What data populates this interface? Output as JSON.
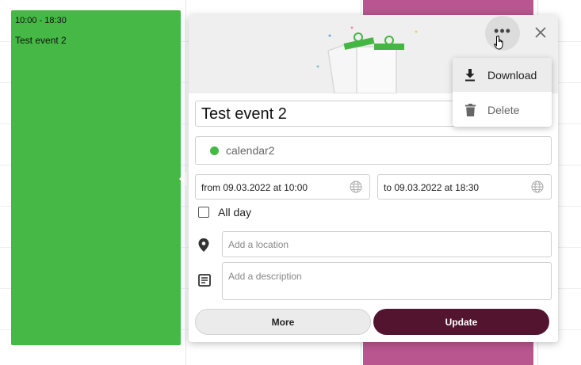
{
  "calendar_events": [
    {
      "time": "10:00 - 18:30",
      "title": "Test event 2",
      "color": "#46b846"
    },
    {
      "color": "#b9568f"
    }
  ],
  "event_popover": {
    "title_value": "Test event 2",
    "calendar": {
      "name": "calendar2",
      "color": "#46b846"
    },
    "date_from": "from 09.03.2022 at 10:00",
    "date_to": "to 09.03.2022 at 18:30",
    "all_day_label": "All day",
    "all_day_checked": false,
    "location_placeholder": "Add a location",
    "description_placeholder": "Add a description",
    "more_button_label": "More",
    "update_button_label": "Update",
    "update_button_color": "#52142e"
  },
  "context_menu": {
    "items": [
      {
        "label": "Download",
        "icon": "download-icon",
        "highlighted": true
      },
      {
        "label": "Delete",
        "icon": "trash-icon",
        "highlighted": false
      }
    ]
  },
  "icons": {
    "more": "more-horizontal-icon",
    "close": "close-icon",
    "location": "location-pin-icon",
    "description": "notes-icon",
    "timezone": "globe-icon"
  }
}
